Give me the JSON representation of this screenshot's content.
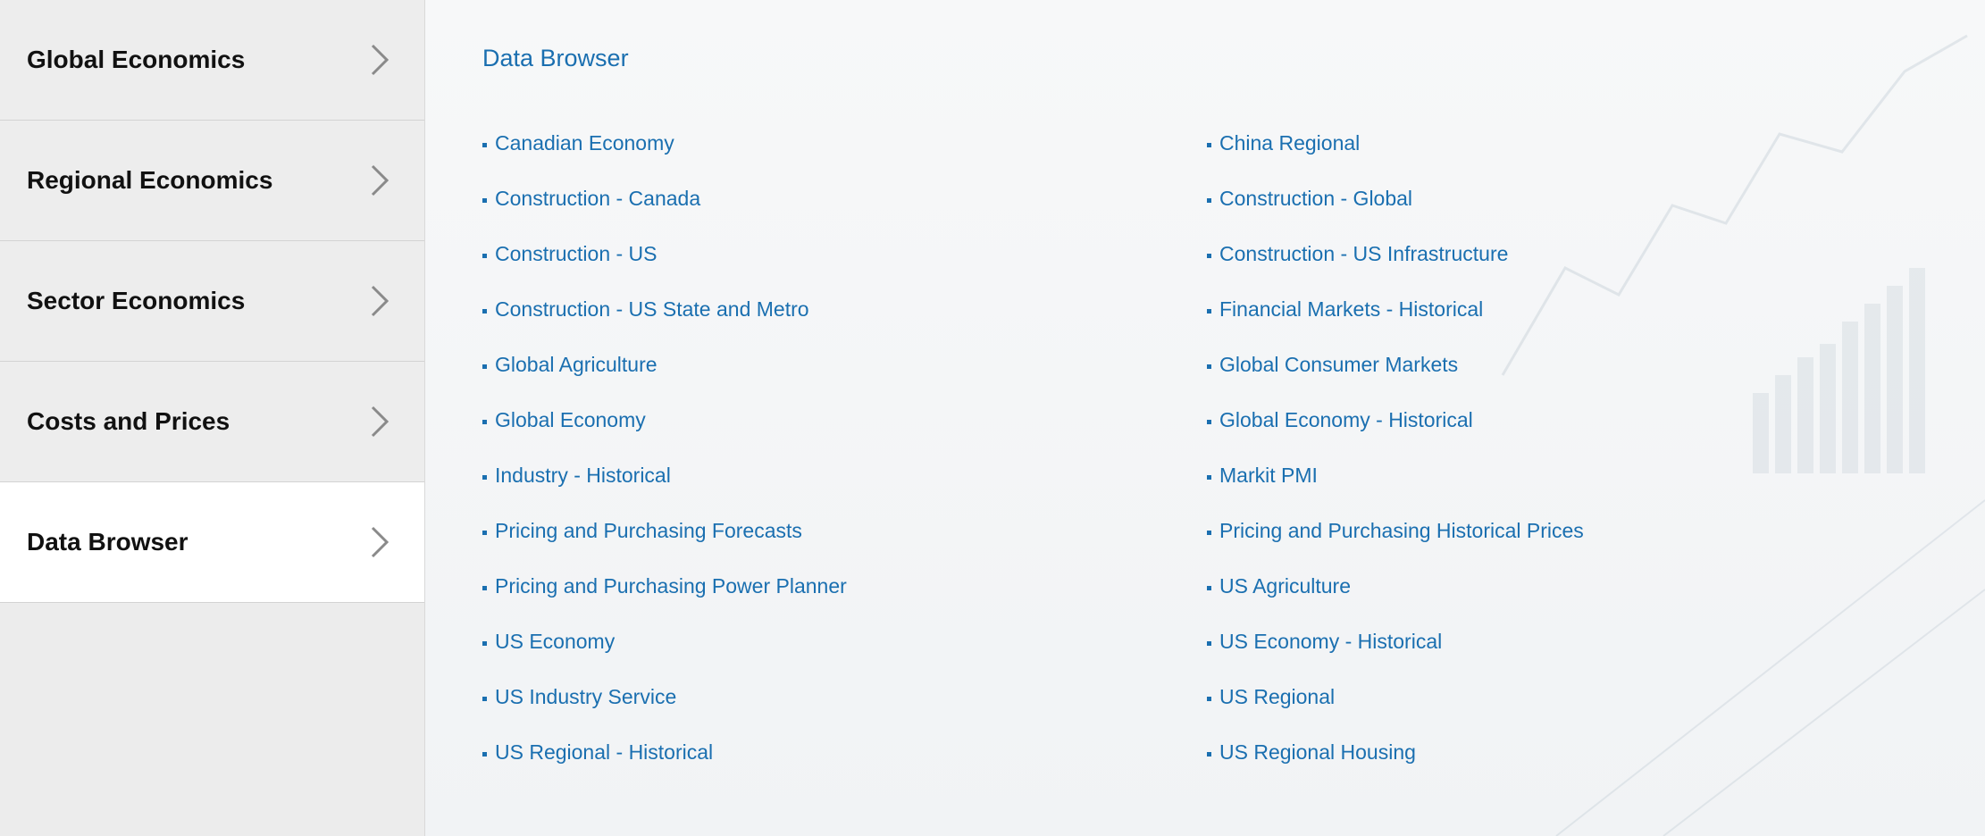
{
  "sidebar": {
    "items": [
      {
        "label": "Global Economics",
        "active": false
      },
      {
        "label": "Regional Economics",
        "active": false
      },
      {
        "label": "Sector Economics",
        "active": false
      },
      {
        "label": "Costs and Prices",
        "active": false
      },
      {
        "label": "Data Browser",
        "active": true
      }
    ]
  },
  "main": {
    "title": "Data Browser",
    "left_links": [
      "Canadian Economy",
      "Construction - Canada",
      "Construction - US",
      "Construction - US State and Metro",
      "Global Agriculture",
      "Global Economy",
      "Industry - Historical",
      "Pricing and Purchasing Forecasts",
      "Pricing and Purchasing Power Planner",
      "US Economy",
      "US Industry Service",
      "US Regional - Historical"
    ],
    "right_links": [
      "China Regional",
      "Construction - Global",
      "Construction - US Infrastructure",
      "Financial Markets - Historical",
      "Global Consumer Markets",
      "Global Economy - Historical",
      "Markit PMI",
      "Pricing and Purchasing Historical Prices",
      "US Agriculture",
      "US Economy - Historical",
      "US Regional",
      "US Regional Housing"
    ]
  },
  "colors": {
    "link": "#1a6fb0",
    "sidebar_bg": "#ececec",
    "active_bg": "#ffffff"
  }
}
